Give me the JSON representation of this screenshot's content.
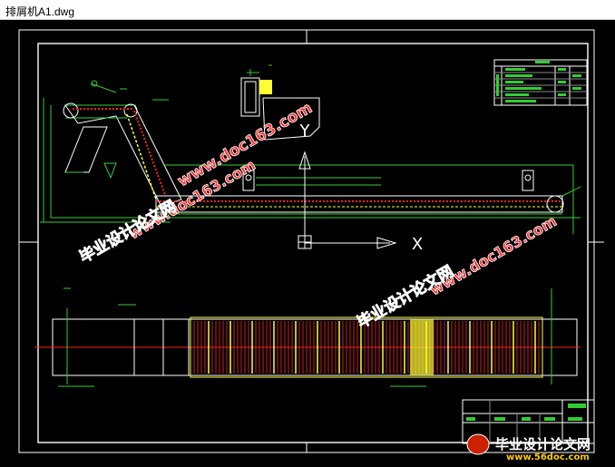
{
  "window": {
    "title": "排屑机A1.dwg"
  },
  "drawing": {
    "axis_labels": {
      "y": "Y",
      "x": "X"
    },
    "colors": {
      "background": "#000000",
      "frame": "#ffffff",
      "green": "#33cc33",
      "red": "#ff2222",
      "yellow": "#ffff33",
      "white": "#ffffff"
    }
  },
  "watermarks": {
    "site_1": "www.doc163.com",
    "site_2": "www.doc163.com",
    "site_3": "www.doc163.com",
    "cn_1": "毕业设计论文网",
    "cn_2": "毕业设计论文网",
    "bottom_cn": "毕业设计论文网",
    "bottom_url": "www.56doc.com"
  }
}
